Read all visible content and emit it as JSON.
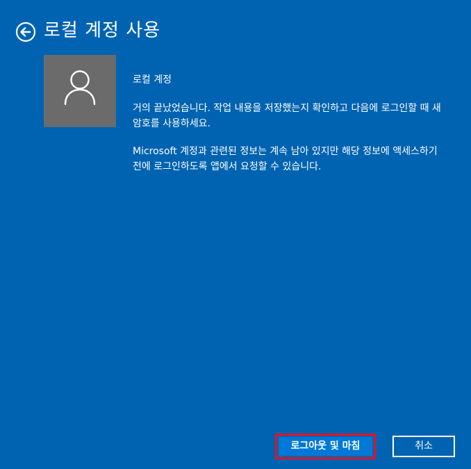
{
  "header": {
    "title": "로컬 계정 사용",
    "back_icon": "back-arrow-circle-icon"
  },
  "avatar": {
    "icon": "user-icon",
    "background_color": "#6B6B6B"
  },
  "content": {
    "account_type": "로컬 계정",
    "paragraph1": "거의 끝났었습니다. 작업 내용을 저장했는지 확인하고 다음에 로그인할 때 새 암호를 사용하세요.",
    "paragraph2": "Microsoft 계정과 관련된 정보는 계속 남아 있지만 해당 정보에 액세스하기 전에 로그인하도록 앱에서 요청할 수 있습니다."
  },
  "buttons": {
    "primary_label": "로그아웃 및 마침",
    "cancel_label": "취소"
  },
  "colors": {
    "background": "#0063B1",
    "primary_button": "#0078D7",
    "highlight_border": "#E81123"
  }
}
